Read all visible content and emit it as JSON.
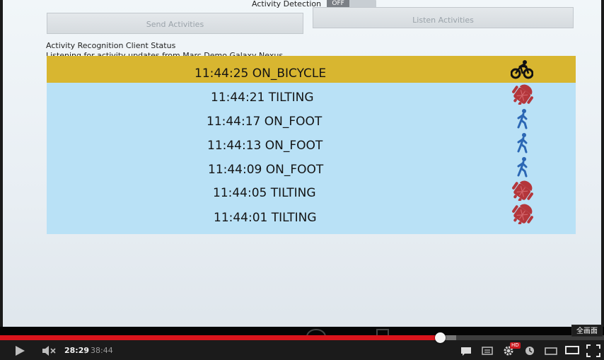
{
  "toggle": {
    "label": "Activity Detection",
    "state": "OFF"
  },
  "buttons": {
    "send": "Send Activities",
    "listen": "Listen Activities"
  },
  "status": {
    "title": "Activity Recognition Client Status",
    "subtitle": "Listening for activity updates from Marc Demo Galaxy Nexus"
  },
  "activities": [
    {
      "text": "11:44:25 ON_BICYCLE",
      "icon": "bicycle-icon"
    },
    {
      "text": "11:44:21 TILTING",
      "icon": "android-tilt-icon"
    },
    {
      "text": "11:44:17 ON_FOOT",
      "icon": "walking-icon"
    },
    {
      "text": "11:44:13 ON_FOOT",
      "icon": "walking-icon"
    },
    {
      "text": "11:44:09 ON_FOOT",
      "icon": "walking-icon"
    },
    {
      "text": "11:44:05 TILTING",
      "icon": "android-tilt-icon"
    },
    {
      "text": "11:44:01 TILTING",
      "icon": "android-tilt-icon"
    }
  ],
  "player": {
    "current_time": "28:29",
    "separator": "/",
    "duration": "38:44",
    "progress_fraction": 0.735,
    "hd_label": "HD",
    "tooltip": "全画面"
  },
  "colors": {
    "highlight": "#d8b630",
    "list_bg": "#b9e1f6",
    "progress": "#d9141c"
  }
}
